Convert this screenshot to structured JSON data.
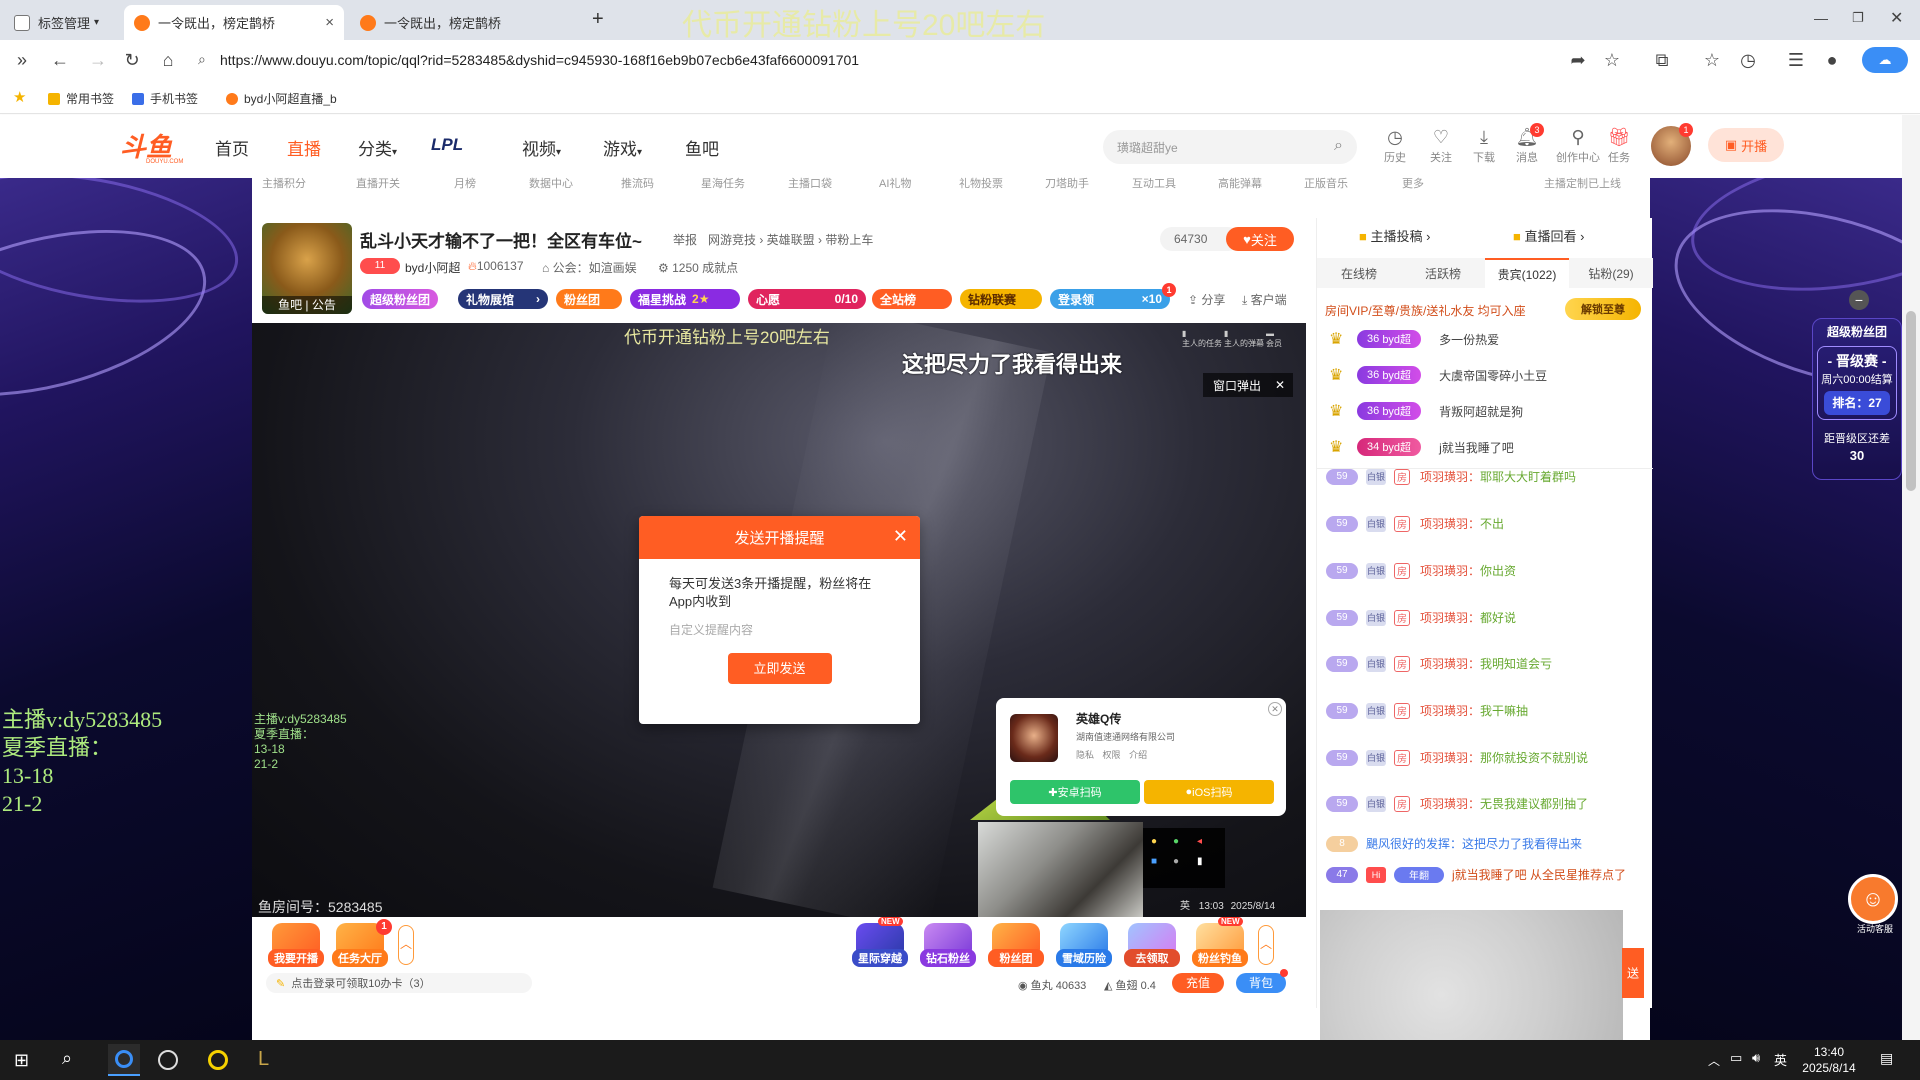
{
  "browser": {
    "tabs": [
      {
        "label": "标签管理"
      },
      {
        "label": "一令既出，榜定鹊桥"
      },
      {
        "label": "一令既出，榜定鹊桥"
      }
    ],
    "overlay_title": "代币开通钻粉上号20吧左右",
    "url": "https://www.douyu.com/topic/qql?rid=5283485&dyshid=c945930-168f16eb9b07ecb6e43faf6600091701",
    "bookmarks": [
      "常用书签",
      "手机书签",
      "byd小阿超直播_b"
    ]
  },
  "header": {
    "logo": "斗鱼",
    "logo_sub": "DOUYU.COM",
    "nav": [
      "首页",
      "直播",
      "分类",
      "LPL",
      "视频",
      "游戏",
      "鱼吧"
    ],
    "search_placeholder": "璜璐超甜ye",
    "icons": [
      {
        "label": "历史",
        "icon": "clock-icon"
      },
      {
        "label": "关注",
        "icon": "heart-icon"
      },
      {
        "label": "下载",
        "icon": "download-icon"
      },
      {
        "label": "消息",
        "icon": "bell-icon",
        "badge": "3"
      },
      {
        "label": "创作中心",
        "icon": "bulb-icon"
      },
      {
        "label": "任务",
        "icon": "gift-icon"
      }
    ],
    "avatar_badge": "1",
    "live_button": "开播"
  },
  "subnav": [
    "主播积分",
    "直播开关",
    "月榜",
    "数据中心",
    "推流码",
    "星海任务",
    "主播口袋",
    "AI礼物",
    "礼物投票",
    "刀塔助手",
    "互动工具",
    "高能弹幕",
    "正版音乐",
    "更多",
    "主播定制已上线"
  ],
  "room": {
    "title": "乱斗小天才输不了一把！全区有车位~",
    "report": "举报",
    "category": "网游竞技 › 英雄联盟 › 带粉上车",
    "streamer_level": "11",
    "streamer": "byd小阿超",
    "hot": "1006137",
    "notice": "公会：如渲画娱",
    "achievement": "1250 成就点",
    "avatar_caption": "鱼吧 | 公告",
    "hot_count": "64730",
    "follow": "关注",
    "tags": [
      "超级粉丝团",
      "礼物展馆",
      "粉丝团",
      "福星挑战",
      "2",
      "心愿",
      "0/10",
      "全站榜",
      "钻粉联赛",
      "登录领",
      "×10"
    ],
    "tag_badge": "1",
    "share": "分享",
    "client": "客户端"
  },
  "video": {
    "top_text": "代币开通钻粉上号20吧左右",
    "danmu": "这把尽力了我看得出来",
    "popout": "窗口弹出",
    "overlay_info": [
      "主播v:dy5283485",
      "夏季直播：",
      "13-18",
      "21-2"
    ],
    "bottom_left": "鱼房间号：5283485",
    "mini_icons": [
      "主人的任务",
      "主人的弹幕",
      "会员"
    ],
    "tray_time": "13:03",
    "tray_date": "2025/8/14",
    "tray_lang": "英"
  },
  "dialog": {
    "title": "发送开播提醒",
    "body": "每天可发送3条开播提醒，粉丝将在App内收到",
    "placeholder": "自定义提醒内容",
    "button": "立即发送"
  },
  "game_ad": {
    "name": "英雄Q传",
    "company": "湖南值速通网络有限公司",
    "links": [
      "隐私",
      "权限",
      "介绍"
    ],
    "android": "安卓扫码",
    "ios": "iOS扫码"
  },
  "bottom": {
    "left_buttons": [
      "我要开播",
      "任务大厅"
    ],
    "task_badge": "1",
    "login_tip": "点击登录可领取10办卡（3）",
    "gifts": [
      {
        "label": "星际穿越",
        "badge": "NEW"
      },
      {
        "label": "钻石粉丝",
        "badge": ""
      },
      {
        "label": "粉丝团",
        "badge": ""
      },
      {
        "label": "雪域历险",
        "badge": ""
      },
      {
        "label": "去领取",
        "badge": ""
      },
      {
        "label": "粉丝钓鱼",
        "badge": "NEW"
      }
    ],
    "fish_ball": "鱼丸 40633",
    "fish_fin": "鱼翅 0.4",
    "recharge": "充值",
    "backpack": "背包"
  },
  "panel": {
    "top_links": [
      "主播投稿",
      "直播回看"
    ],
    "tabs": [
      "在线榜",
      "活跃榜",
      "贵宾(1022)",
      "钻粉(29)"
    ],
    "vip_line": "房间VIP/至尊/贵族/送礼水友 均可入座",
    "unlock": "解锁至尊",
    "ranks": [
      {
        "tag": "36",
        "name": "byd超",
        "text": "多一份热爱"
      },
      {
        "tag": "36",
        "name": "byd超",
        "text": "大虞帝国零碎小土豆"
      },
      {
        "tag": "36",
        "name": "byd超",
        "text": "背叛阿超就是狗"
      },
      {
        "tag": "34",
        "name": "byd超",
        "text": "j就当我睡了吧"
      }
    ],
    "chat": [
      {
        "lv": "59",
        "medal": "白银",
        "room": "房",
        "name": "项羽璜羽：",
        "text": "耶耶大大盯着群吗"
      },
      {
        "lv": "59",
        "medal": "白银",
        "room": "房",
        "name": "项羽璜羽：",
        "text": "不出"
      },
      {
        "lv": "59",
        "medal": "白银",
        "room": "房",
        "name": "项羽璜羽：",
        "text": "你出资"
      },
      {
        "lv": "59",
        "medal": "白银",
        "room": "房",
        "name": "项羽璜羽：",
        "text": "都好说"
      },
      {
        "lv": "59",
        "medal": "白银",
        "room": "房",
        "name": "项羽璜羽：",
        "text": "我明知道会亏"
      },
      {
        "lv": "59",
        "medal": "白银",
        "room": "房",
        "name": "项羽璜羽：",
        "text": "我干嘛抽"
      },
      {
        "lv": "59",
        "medal": "白银",
        "room": "房",
        "name": "项羽璜羽：",
        "text": "那你就投资不就别说"
      },
      {
        "lv": "59",
        "medal": "白银",
        "room": "房",
        "name": "项羽璜羽：",
        "text": "无畏我建议都别抽了"
      }
    ],
    "sys_line1_lv": "8",
    "sys_line1": "颶风很好的发挥：这把尽力了我看得出来",
    "sys_line2_lv": "47",
    "sys_line2_tag": "年翻",
    "sys_line2": "j就当我睡了吧 从全民星推荐点了",
    "send": "送"
  },
  "side": {
    "superfan_title": "超级粉丝团",
    "superfan_event": "- 晋级赛 -",
    "superfan_time": "周六00:00结算",
    "superfan_rank": "排名：27",
    "superfan_gap_label": "距晋级区还差",
    "superfan_gap": "30",
    "close": "−",
    "helper": "活动客服"
  },
  "left_overlay": [
    "主播v:dy5283485",
    "夏季直播：",
    "13-18",
    "21-2"
  ],
  "taskbar": {
    "time": "13:40",
    "date": "2025/8/14",
    "lang": "英"
  }
}
